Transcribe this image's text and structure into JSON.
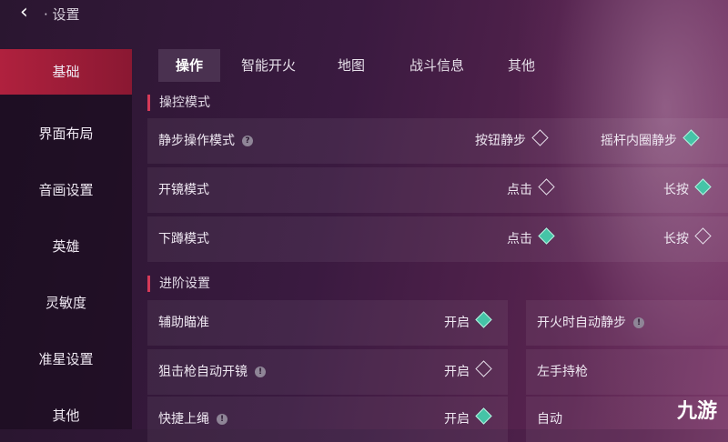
{
  "header": {
    "title": "设置"
  },
  "sidebar": {
    "items": [
      "基础",
      "界面布局",
      "音画设置",
      "英雄",
      "灵敏度",
      "准星设置",
      "其他"
    ]
  },
  "tabs": [
    "操作",
    "智能开火",
    "地图",
    "战斗信息",
    "其他"
  ],
  "sections": {
    "control": "操控模式",
    "advanced": "进阶设置"
  },
  "control_rows": [
    {
      "label": "静步操作模式",
      "opt1": "按钮静步",
      "opt1_on": false,
      "opt2": "摇杆内圈静步",
      "opt2_on": true
    },
    {
      "label": "开镜模式",
      "opt1": "点击",
      "opt1_on": false,
      "opt2": "长按",
      "opt2_on": true
    },
    {
      "label": "下蹲模式",
      "opt1": "点击",
      "opt1_on": true,
      "opt2": "长按",
      "opt2_on": false
    }
  ],
  "adv_left": [
    {
      "label": "辅助瞄准",
      "value": "开启",
      "on": true
    },
    {
      "label": "狙击枪自动开镜",
      "value": "开启",
      "on": false
    },
    {
      "label": "快捷上绳",
      "value": "开启",
      "on": true
    }
  ],
  "adv_right": [
    {
      "label": "开火时自动静步"
    },
    {
      "label": "左手持枪"
    },
    {
      "label": "自动"
    }
  ],
  "watermark": "九游"
}
